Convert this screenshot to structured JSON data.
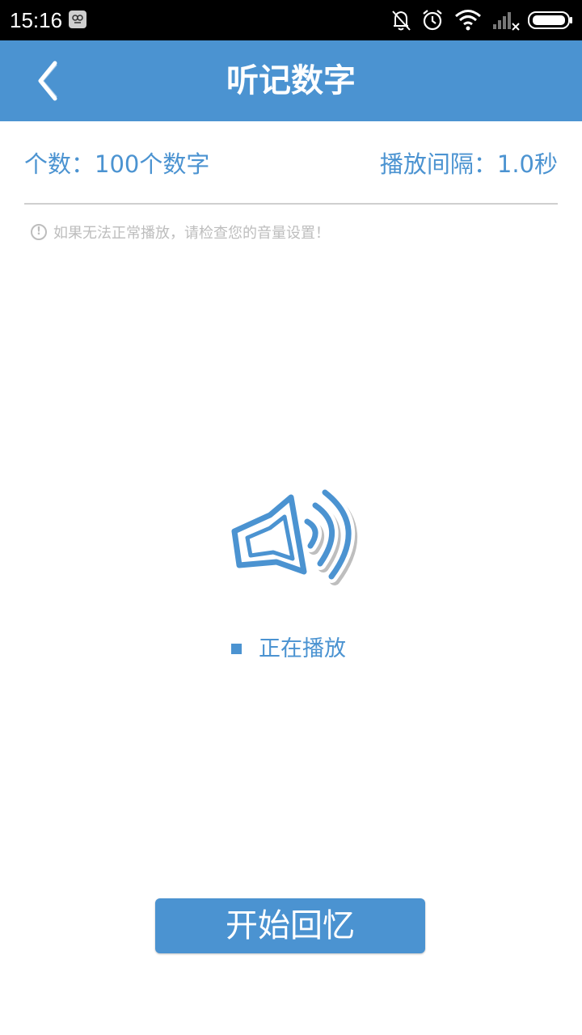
{
  "status_bar": {
    "time": "15:16",
    "icons": [
      "app-notification-icon",
      "bell-off-icon",
      "alarm-clock-icon",
      "wifi-icon",
      "signal-icon",
      "battery-icon"
    ]
  },
  "header": {
    "title": "听记数字",
    "back_icon": "chevron-left-icon"
  },
  "settings": {
    "count_label": "个数：100个数字",
    "interval_label": "播放间隔：1.0秒"
  },
  "notice": {
    "icon": "!",
    "text": "如果无法正常播放，请检查您的音量设置！"
  },
  "player": {
    "icon": "speaker-icon",
    "status_text": "正在播放"
  },
  "actions": {
    "recall_label": "开始回忆"
  },
  "colors": {
    "accent": "#4b93d1",
    "status_bar": "#000000",
    "muted_text": "#bdbdbd",
    "divider": "#cfcfcf"
  }
}
